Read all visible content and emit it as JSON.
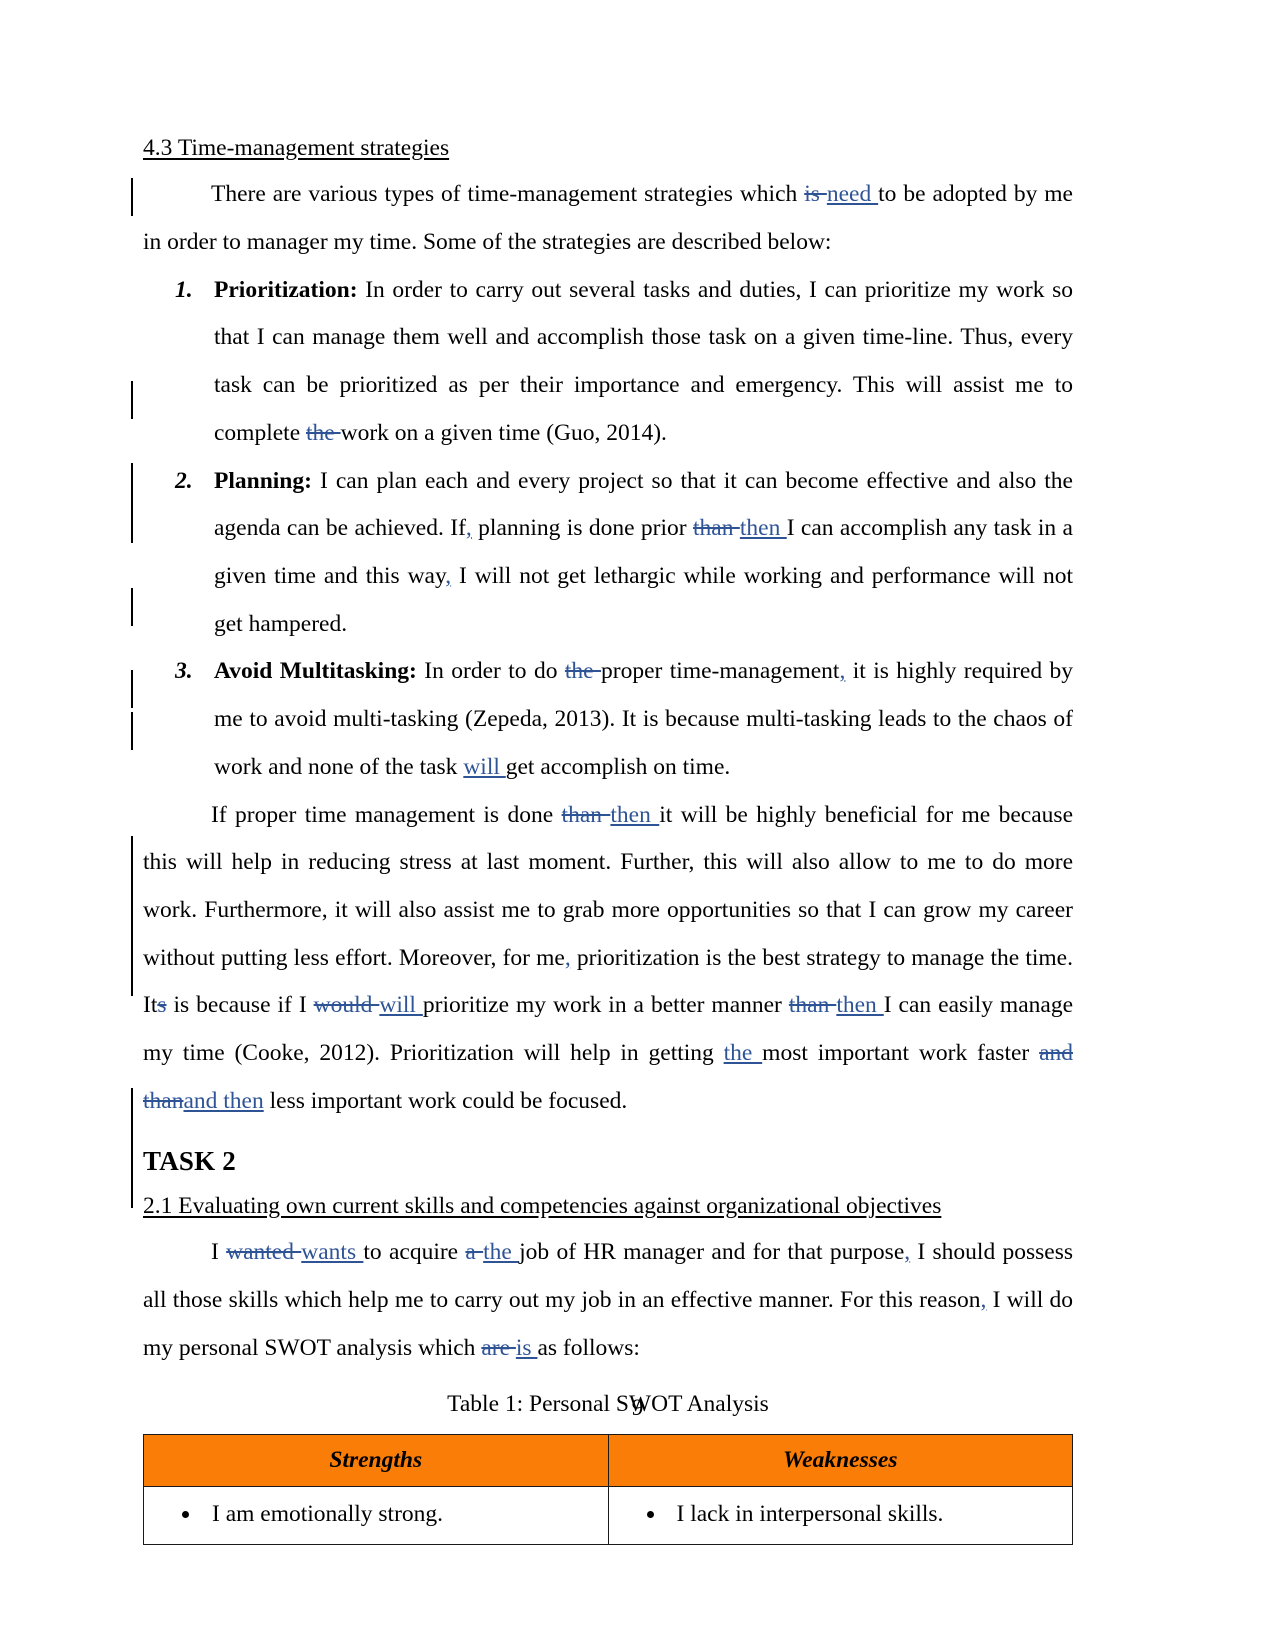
{
  "document": {
    "page_number": "9",
    "accent_colors": {
      "tracked_change_blue": "#2f5496",
      "table_header_orange": "#fa7d07"
    }
  },
  "section_4_3": {
    "heading": "4.3 Time-management strategies",
    "intro": {
      "p1": "There are various types of time-management strategies which ",
      "del1": "is ",
      "ins1": "need ",
      "p2": "to be adopted by me in order to manager my time. Some of the strategies are described below:"
    },
    "items": [
      {
        "number": "1.",
        "lead": "Prioritization:",
        "t1": " In order to carry out several tasks and duties, I can prioritize my work so that I can manage them well and accomplish those task on a given time-line. Thus, every task can be prioritized as per their importance and emergency. This will assist me to complete ",
        "del1": "the ",
        "t2": "work on a given time (Guo, 2014)."
      },
      {
        "number": "2.",
        "lead": "Planning:",
        "t1": " I can plan each and every project so that it can become effective and also the agenda can be achieved. If",
        "ins1": ",",
        "t2": " planning is done prior ",
        "del1": "than ",
        "ins2": "then ",
        "t3": "I can accomplish any task in a given time and this way",
        "ins3": ",",
        "t4": " I will not get lethargic while working and performance will not get hampered."
      },
      {
        "number": "3.",
        "lead": "Avoid Multitasking:",
        "t1": " In order to do ",
        "del1": "the ",
        "t2": "proper time-management",
        "ins1": ",",
        "t3": " it is highly required by me to avoid multi-tasking (Zepeda, 2013). It is because multi-tasking leads to the chaos of work and none of the task ",
        "ins2": "will ",
        "t4": "get accomplish on time."
      }
    ],
    "closing": {
      "t1": "If proper time management is done ",
      "del1": "than ",
      "ins1": "then ",
      "t2": "it will be highly beneficial for me because this will help in reducing stress at last moment. Further, this will also allow to me to do more work. Furthermore, it will also assist me to grab more opportunities so that I can grow my career without putting less effort. Moreover, for me",
      "ins2": ",",
      "t3": " prioritization is the best strategy to manage the time. It",
      "del2": "s",
      "t4": " is because if I ",
      "del3": "would ",
      "ins3": "will ",
      "t5": "prioritize my work in a better manner ",
      "del4": "than ",
      "ins4": "then ",
      "t6": "I can easily manage my time (Cooke, 2012). Prioritization will help in getting ",
      "ins5": "the ",
      "t7": "most important work faster ",
      "del5": "and than",
      "ins6": "and then",
      "t8": " less important work could be focused."
    }
  },
  "task_2": {
    "heading": "TASK 2",
    "section_2_1": {
      "heading": "2.1 Evaluating own current skills and competencies against organizational objectives",
      "paragraph": {
        "t1": "I ",
        "del1": "wanted ",
        "ins1": "wants ",
        "t2": "to acquire ",
        "del2": "a ",
        "ins2": "the ",
        "t3": "job of HR manager and for that purpose",
        "ins3": ",",
        "t4": " I should possess all those skills which help me to carry out my job in an effective manner. For this reason",
        "ins4": ",",
        "t5": " I will do my personal SWOT analysis which ",
        "del3": "are ",
        "ins5": "is ",
        "t6": "as follows:"
      }
    },
    "table": {
      "caption": "Table 1: Personal SWOT Analysis",
      "headers": [
        "Strengths",
        "Weaknesses"
      ],
      "rows": [
        [
          "I am emotionally strong.",
          "I lack in interpersonal skills."
        ]
      ]
    }
  }
}
